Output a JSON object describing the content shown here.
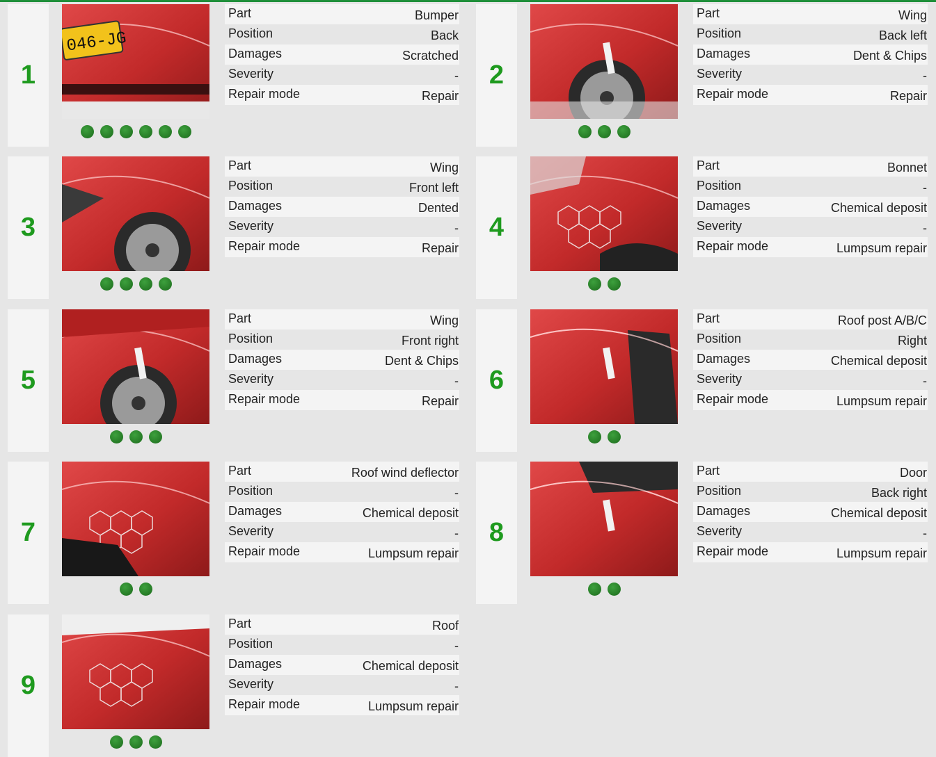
{
  "colors": {
    "accent": "#1e9a1e",
    "dot": "#2a8a2a",
    "top_line": "#1f8f3a"
  },
  "labels": {
    "part": "Part",
    "position": "Position",
    "damages": "Damages",
    "severity": "Severity",
    "repair_mode": "Repair mode"
  },
  "damages": [
    {
      "number": "1",
      "part": "Bumper",
      "position": "Back",
      "damages": "Scratched",
      "severity": "-",
      "repair_mode": "Repair",
      "photo_count": 6,
      "plate": "046-JG"
    },
    {
      "number": "2",
      "part": "Wing",
      "position": "Back left",
      "damages": "Dent & Chips",
      "severity": "-",
      "repair_mode": "Repair",
      "photo_count": 3
    },
    {
      "number": "3",
      "part": "Wing",
      "position": "Front left",
      "damages": "Dented",
      "severity": "-",
      "repair_mode": "Repair",
      "photo_count": 4
    },
    {
      "number": "4",
      "part": "Bonnet",
      "position": "-",
      "damages": "Chemical deposit",
      "severity": "-",
      "repair_mode": "Lumpsum repair",
      "photo_count": 2
    },
    {
      "number": "5",
      "part": "Wing",
      "position": "Front right",
      "damages": "Dent & Chips",
      "severity": "-",
      "repair_mode": "Repair",
      "photo_count": 3
    },
    {
      "number": "6",
      "part": "Roof post A/B/C",
      "position": "Right",
      "damages": "Chemical deposit",
      "severity": "-",
      "repair_mode": "Lumpsum repair",
      "photo_count": 2
    },
    {
      "number": "7",
      "part": "Roof wind deflector",
      "position": "-",
      "damages": "Chemical deposit",
      "severity": "-",
      "repair_mode": "Lumpsum repair",
      "photo_count": 2
    },
    {
      "number": "8",
      "part": "Door",
      "position": "Back right",
      "damages": "Chemical deposit",
      "severity": "-",
      "repair_mode": "Lumpsum repair",
      "photo_count": 2
    },
    {
      "number": "9",
      "part": "Roof",
      "position": "-",
      "damages": "Chemical deposit",
      "severity": "-",
      "repair_mode": "Lumpsum repair",
      "photo_count": 3
    }
  ]
}
